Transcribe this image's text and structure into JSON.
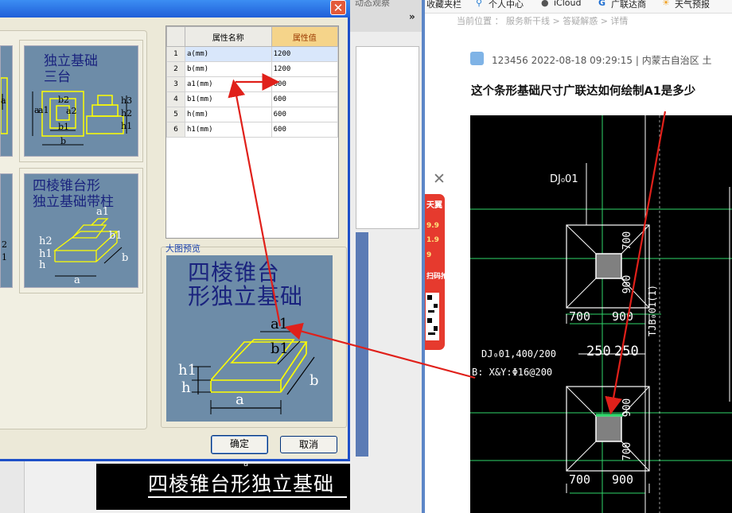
{
  "cad": {
    "bottom_title": "四棱锥台形独立基础",
    "bottom_small": "a"
  },
  "browser_tabs": {
    "fragment": "动态观察",
    "more": "»"
  },
  "dialog": {
    "close_label": "✕",
    "thumbnails": [
      {
        "title_line1": "独立基础",
        "title_line2": "三台",
        "labels": [
          "a",
          "a1",
          "b2",
          "a2",
          "b1",
          "b",
          "h3",
          "h2",
          "h1"
        ]
      },
      {
        "title_line1": "四棱锥台形",
        "title_line2": "独立基础带柱",
        "labels": [
          "a1",
          "b1",
          "h2",
          "h1",
          "h",
          "b",
          "a"
        ]
      }
    ],
    "left_edge_labels": [
      "a",
      "2",
      "1"
    ],
    "table": {
      "headers": [
        "属性名称",
        "属性值"
      ],
      "rows": [
        {
          "index": "1",
          "name": "a(mm)",
          "value": "1200"
        },
        {
          "index": "2",
          "name": "b(mm)",
          "value": "1200"
        },
        {
          "index": "3",
          "name": "a1(mm)",
          "value": "600"
        },
        {
          "index": "4",
          "name": "b1(mm)",
          "value": "600"
        },
        {
          "index": "5",
          "name": "h(mm)",
          "value": "600"
        },
        {
          "index": "6",
          "name": "h1(mm)",
          "value": "600"
        }
      ]
    },
    "preview_label": "大图预览",
    "preview": {
      "title_line1": "四棱锥台",
      "title_line2": "形独立基础",
      "labels": {
        "a1": "a1",
        "b1": "b1",
        "h1": "h1",
        "h": "h",
        "b": "b",
        "a": "a"
      }
    },
    "ok_label": "确定",
    "cancel_label": "取消"
  },
  "browser": {
    "bookmarks": [
      "收藏夹栏",
      "个人中心",
      "iCloud",
      "广联达商",
      "天气预报"
    ],
    "breadcrumb": "当前位置 ： 服务新干线 > 答疑解惑 > 详情",
    "post_meta": "123456   2022-08-18 09:29:15   |   内蒙古自治区 土",
    "post_title": "这个条形基础尺寸广联达如何绘制A1是多少",
    "close_x": "✕",
    "ad_texts": [
      "天翼",
      "9.9",
      "1.9",
      "9",
      "扫码抢"
    ],
    "cad": {
      "label_top": "DJ₀01",
      "dim_700_a": "700",
      "dim_900_a": "900",
      "dim_700_v": "700",
      "dim_900_v": "900",
      "dim_250_a": "250",
      "dim_250_b": "250",
      "tjb": "TJB₀01(1)",
      "label_mid1": "DJ₀01,400/200",
      "label_mid2": "B: X&Y:Φ16@200",
      "dim_700_c": "700",
      "dim_900_c": "900",
      "dim_900_v2": "900",
      "dim_700_v2": "700"
    }
  },
  "colors": {
    "dialog_bg": "#ece9d8",
    "thumb_bg": "#6d8ca8",
    "title_blue": "#1a237e",
    "annotation_red": "#e0201a",
    "cad_green": "#2fd66a",
    "cad_yellow": "#ffff00"
  }
}
